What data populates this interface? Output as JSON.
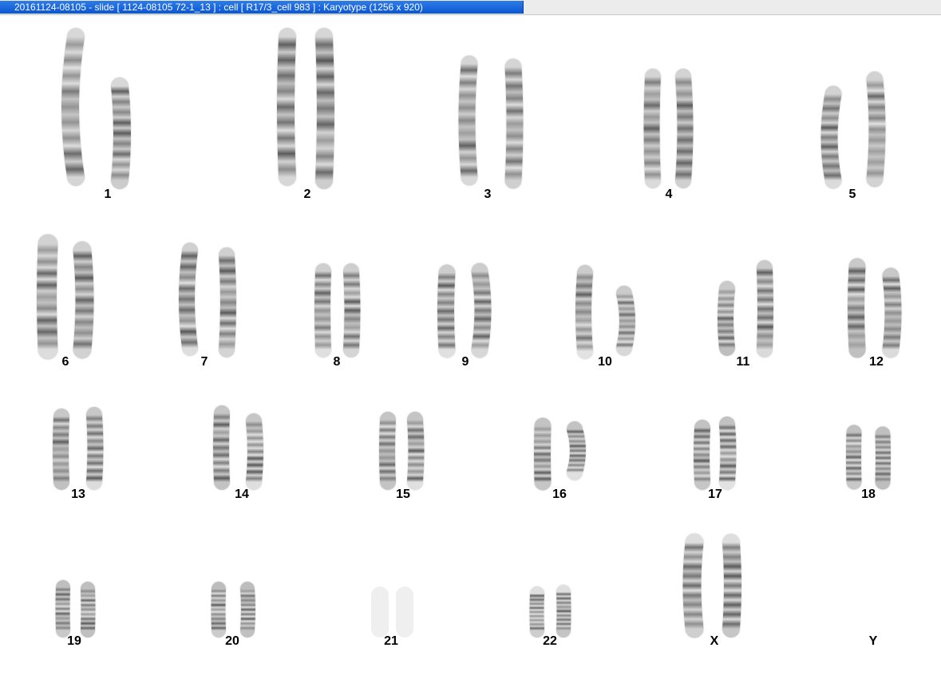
{
  "window": {
    "title": "20161124-08105 - slide [ 1124-08105 72-1_13 ] : cell [ R17/3_cell 983 ] : Karyotype  (1256 x 920)"
  },
  "colors": {
    "titlebar": "#0a56d6",
    "title_text": "#ffffff",
    "background": "#ffffff",
    "chromosome_light": "#d6d6d6",
    "chromosome_dark": "#4d4d4d",
    "label": "#000000"
  },
  "karyotype": {
    "chromosomes": [
      {
        "label": "1",
        "homologs": 2
      },
      {
        "label": "2",
        "homologs": 2
      },
      {
        "label": "3",
        "homologs": 2
      },
      {
        "label": "4",
        "homologs": 2
      },
      {
        "label": "5",
        "homologs": 2
      },
      {
        "label": "6",
        "homologs": 2
      },
      {
        "label": "7",
        "homologs": 2
      },
      {
        "label": "8",
        "homologs": 2
      },
      {
        "label": "9",
        "homologs": 2
      },
      {
        "label": "10",
        "homologs": 2
      },
      {
        "label": "11",
        "homologs": 2
      },
      {
        "label": "12",
        "homologs": 2
      },
      {
        "label": "13",
        "homologs": 2
      },
      {
        "label": "14",
        "homologs": 2
      },
      {
        "label": "15",
        "homologs": 2
      },
      {
        "label": "16",
        "homologs": 2
      },
      {
        "label": "17",
        "homologs": 2
      },
      {
        "label": "18",
        "homologs": 2
      },
      {
        "label": "19",
        "homologs": 2
      },
      {
        "label": "20",
        "homologs": 2
      },
      {
        "label": "21",
        "homologs": 2
      },
      {
        "label": "22",
        "homologs": 2
      },
      {
        "label": "X",
        "homologs": 2
      },
      {
        "label": "Y",
        "homologs": 0
      }
    ]
  }
}
